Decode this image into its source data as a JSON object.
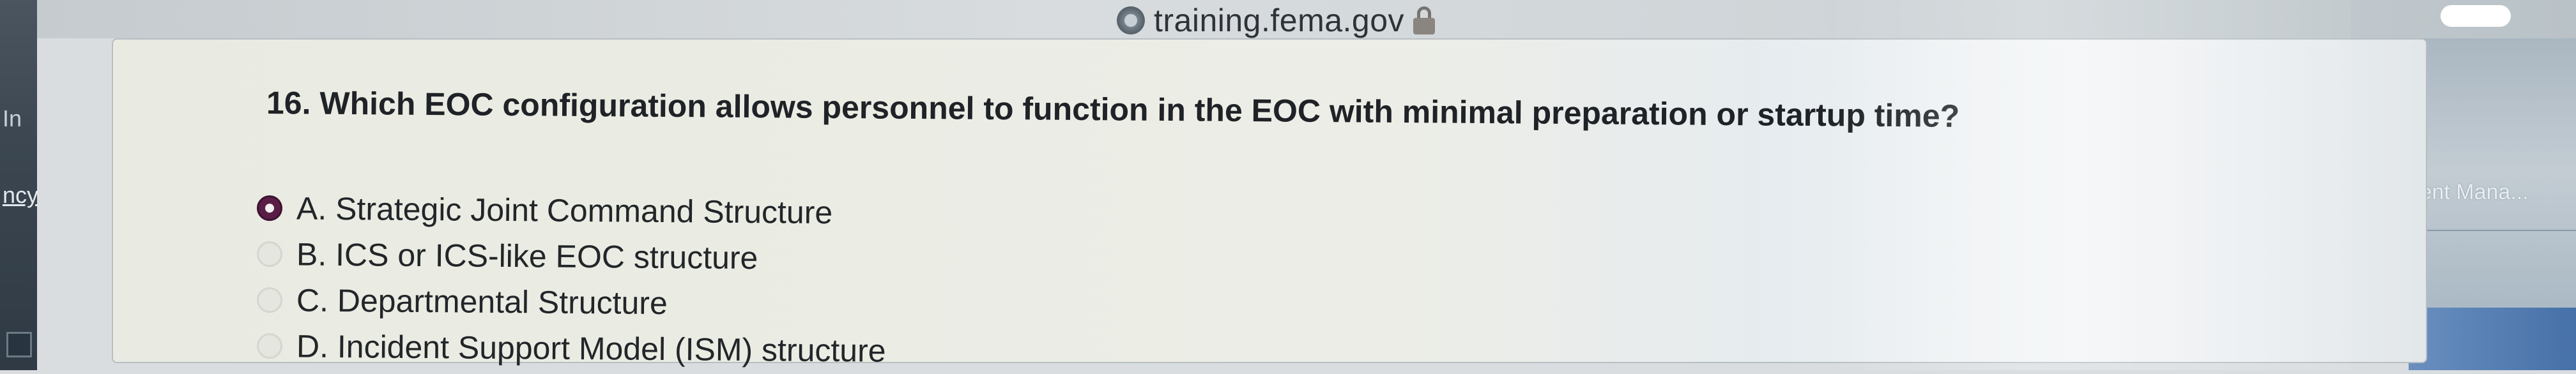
{
  "browser": {
    "url_domain": "training.fema.gov",
    "seal_icon": "dhs-seal-icon",
    "lock_icon": "lock-icon",
    "left_edge_texts": [
      "In",
      "ncy"
    ],
    "right_edge_text": "ient Mana..."
  },
  "quiz": {
    "question": "16. Which EOC configuration allows personnel to function in the EOC with minimal preparation or startup time?",
    "options": [
      {
        "label": "A. Strategic Joint Command Structure",
        "selected": true
      },
      {
        "label": "B. ICS or ICS-like EOC structure",
        "selected": false
      },
      {
        "label": "C. Departmental Structure",
        "selected": false
      },
      {
        "label": "D. Incident Support Model (ISM) structure",
        "selected": false
      }
    ],
    "selected_color": "#5a1e46"
  }
}
